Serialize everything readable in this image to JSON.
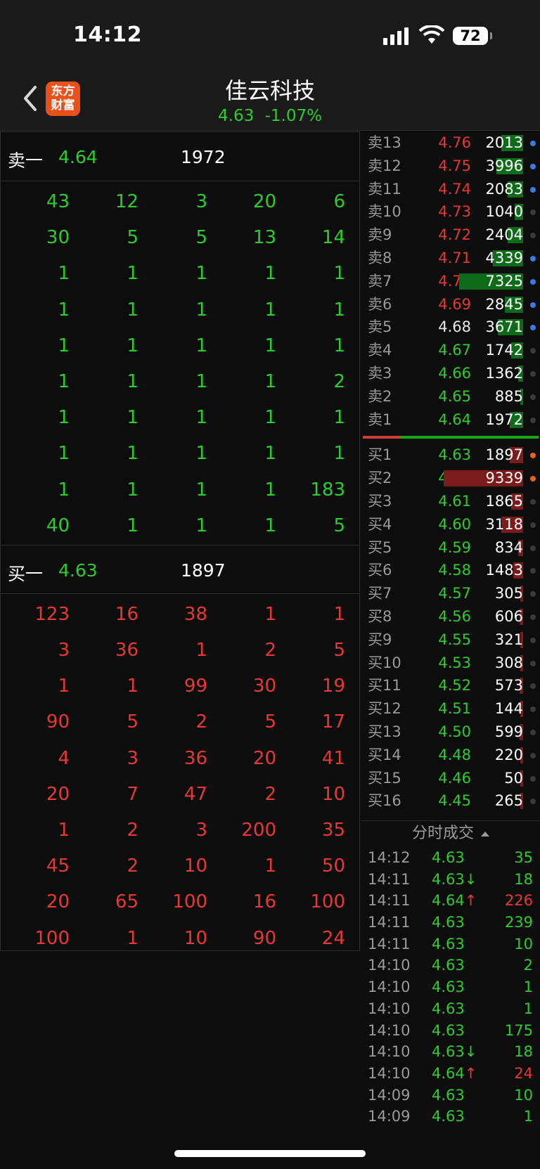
{
  "status_bar": {
    "time": "14:12",
    "battery": "72"
  },
  "header": {
    "logo_line1": "东方",
    "logo_line2": "财富",
    "title": "佳云科技",
    "price": "4.63",
    "change": "-1.07%"
  },
  "sell1": {
    "label": "卖一",
    "price": "4.64",
    "volume": "1972"
  },
  "sell_queue": [
    [
      "43",
      "12",
      "3",
      "20",
      "6"
    ],
    [
      "30",
      "5",
      "5",
      "13",
      "14"
    ],
    [
      "1",
      "1",
      "1",
      "1",
      "1"
    ],
    [
      "1",
      "1",
      "1",
      "1",
      "1"
    ],
    [
      "1",
      "1",
      "1",
      "1",
      "1"
    ],
    [
      "1",
      "1",
      "1",
      "1",
      "2"
    ],
    [
      "1",
      "1",
      "1",
      "1",
      "1"
    ],
    [
      "1",
      "1",
      "1",
      "1",
      "1"
    ],
    [
      "1",
      "1",
      "1",
      "1",
      "183"
    ],
    [
      "40",
      "1",
      "1",
      "1",
      "5"
    ]
  ],
  "buy1": {
    "label": "买一",
    "price": "4.63",
    "volume": "1897"
  },
  "buy_queue": [
    [
      "123",
      "16",
      "38",
      "1",
      "1"
    ],
    [
      "3",
      "36",
      "1",
      "2",
      "5"
    ],
    [
      "1",
      "1",
      "99",
      "30",
      "19"
    ],
    [
      "90",
      "5",
      "2",
      "5",
      "17"
    ],
    [
      "4",
      "3",
      "36",
      "20",
      "41"
    ],
    [
      "20",
      "7",
      "47",
      "2",
      "10"
    ],
    [
      "1",
      "2",
      "3",
      "200",
      "35"
    ],
    [
      "45",
      "2",
      "10",
      "1",
      "50"
    ],
    [
      "20",
      "65",
      "100",
      "16",
      "100"
    ],
    [
      "100",
      "1",
      "10",
      "90",
      "24"
    ]
  ],
  "asks": [
    {
      "label": "卖13",
      "price": "4.76",
      "volume": "2013",
      "color": "red",
      "bar": 0.26,
      "dot": "blue"
    },
    {
      "label": "卖12",
      "price": "4.75",
      "volume": "3996",
      "color": "red",
      "bar": 0.32,
      "dot": "blue"
    },
    {
      "label": "卖11",
      "price": "4.74",
      "volume": "2083",
      "color": "red",
      "bar": 0.18,
      "dot": "blue"
    },
    {
      "label": "卖10",
      "price": "4.73",
      "volume": "1040",
      "color": "red",
      "bar": 0.1,
      "dot": "dk"
    },
    {
      "label": "卖9",
      "price": "4.72",
      "volume": "2404",
      "color": "red",
      "bar": 0.18,
      "dot": "dk"
    },
    {
      "label": "卖8",
      "price": "4.71",
      "volume": "4339",
      "color": "red",
      "bar": 0.36,
      "dot": "blue"
    },
    {
      "label": "卖7",
      "price": "4.70",
      "volume": "7325",
      "color": "red",
      "bar": 0.76,
      "dot": "blue"
    },
    {
      "label": "卖6",
      "price": "4.69",
      "volume": "2845",
      "color": "red",
      "bar": 0.22,
      "dot": "blue"
    },
    {
      "label": "卖5",
      "price": "4.68",
      "volume": "3671",
      "color": "white",
      "bar": 0.3,
      "dot": "blue"
    },
    {
      "label": "卖4",
      "price": "4.67",
      "volume": "1742",
      "color": "green",
      "bar": 0.14,
      "dot": "dk"
    },
    {
      "label": "卖3",
      "price": "4.66",
      "volume": "1362",
      "color": "green",
      "bar": 0.06,
      "dot": "dk"
    },
    {
      "label": "卖2",
      "price": "4.65",
      "volume": "885",
      "color": "green",
      "bar": 0.03,
      "dot": "dk"
    },
    {
      "label": "卖1",
      "price": "4.64",
      "volume": "1972",
      "color": "green",
      "bar": 0.16,
      "dot": "dk"
    }
  ],
  "bids": [
    {
      "label": "买1",
      "price": "4.63",
      "volume": "1897",
      "bar": 0.16,
      "dot": "orange"
    },
    {
      "label": "买2",
      "price": "4.62",
      "volume": "9339",
      "bar": 0.94,
      "dot": "orange"
    },
    {
      "label": "买3",
      "price": "4.61",
      "volume": "1865",
      "bar": 0.14,
      "dot": "dk"
    },
    {
      "label": "买4",
      "price": "4.60",
      "volume": "3118",
      "bar": 0.26,
      "dot": "dk"
    },
    {
      "label": "买5",
      "price": "4.59",
      "volume": "834",
      "bar": 0.06,
      "dot": "dk"
    },
    {
      "label": "买6",
      "price": "4.58",
      "volume": "1483",
      "bar": 0.12,
      "dot": "dk"
    },
    {
      "label": "买7",
      "price": "4.57",
      "volume": "305",
      "bar": 0.03,
      "dot": "dk"
    },
    {
      "label": "买8",
      "price": "4.56",
      "volume": "606",
      "bar": 0.04,
      "dot": "dk"
    },
    {
      "label": "买9",
      "price": "4.55",
      "volume": "321",
      "bar": 0.03,
      "dot": "dk"
    },
    {
      "label": "买10",
      "price": "4.53",
      "volume": "308",
      "bar": 0.03,
      "dot": "dk"
    },
    {
      "label": "买11",
      "price": "4.52",
      "volume": "573",
      "bar": 0.04,
      "dot": "dk"
    },
    {
      "label": "买12",
      "price": "4.51",
      "volume": "144",
      "bar": 0.02,
      "dot": "dk"
    },
    {
      "label": "买13",
      "price": "4.50",
      "volume": "599",
      "bar": 0.04,
      "dot": "dk"
    },
    {
      "label": "买14",
      "price": "4.48",
      "volume": "220",
      "bar": 0.02,
      "dot": "dk"
    },
    {
      "label": "买15",
      "price": "4.46",
      "volume": "50",
      "bar": 0.01,
      "dot": "dk"
    },
    {
      "label": "买16",
      "price": "4.45",
      "volume": "265",
      "bar": 0.02,
      "dot": "dk"
    }
  ],
  "trades_header": "分时成交",
  "trades": [
    {
      "time": "14:12",
      "price": "4.63",
      "arrow": "",
      "volume": "35",
      "color": "green"
    },
    {
      "time": "14:11",
      "price": "4.63",
      "arrow": "↓",
      "volume": "18",
      "color": "green"
    },
    {
      "time": "14:11",
      "price": "4.64",
      "arrow": "↑",
      "volume": "226",
      "color": "red"
    },
    {
      "time": "14:11",
      "price": "4.63",
      "arrow": "",
      "volume": "239",
      "color": "green"
    },
    {
      "time": "14:11",
      "price": "4.63",
      "arrow": "",
      "volume": "10",
      "color": "green"
    },
    {
      "time": "14:10",
      "price": "4.63",
      "arrow": "",
      "volume": "2",
      "color": "green"
    },
    {
      "time": "14:10",
      "price": "4.63",
      "arrow": "",
      "volume": "1",
      "color": "green"
    },
    {
      "time": "14:10",
      "price": "4.63",
      "arrow": "",
      "volume": "1",
      "color": "green"
    },
    {
      "time": "14:10",
      "price": "4.63",
      "arrow": "",
      "volume": "175",
      "color": "green"
    },
    {
      "time": "14:10",
      "price": "4.63",
      "arrow": "↓",
      "volume": "18",
      "color": "green"
    },
    {
      "time": "14:10",
      "price": "4.64",
      "arrow": "↑",
      "volume": "24",
      "color": "red"
    },
    {
      "time": "14:09",
      "price": "4.63",
      "arrow": "",
      "volume": "10",
      "color": "green"
    },
    {
      "time": "14:09",
      "price": "4.63",
      "arrow": "",
      "volume": "1",
      "color": "green"
    }
  ]
}
